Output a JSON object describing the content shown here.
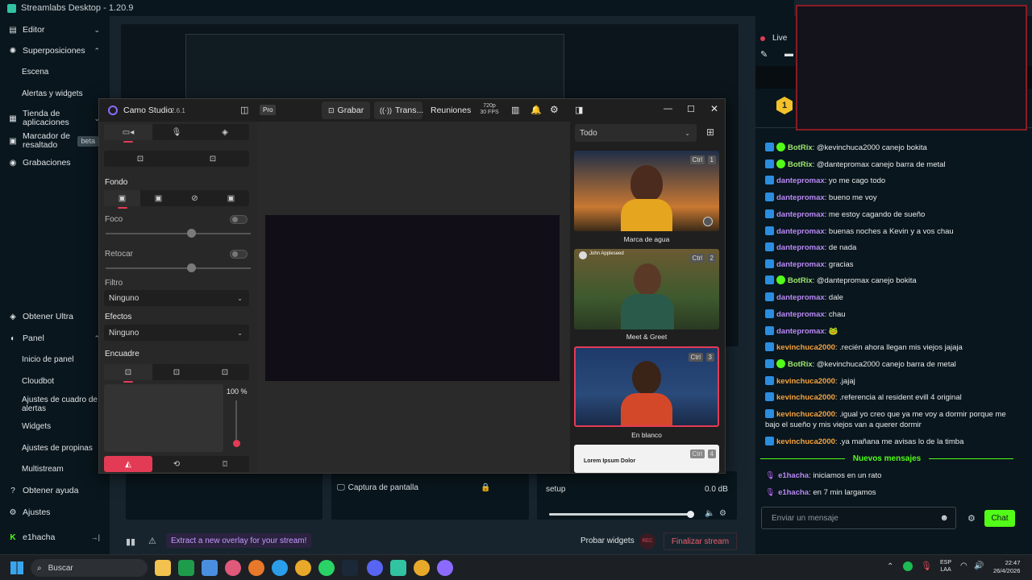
{
  "titlebar": {
    "title": "Streamlabs Desktop - 1.20.9"
  },
  "sidebar": {
    "items": [
      {
        "label": "Editor",
        "icon": "editor-icon"
      },
      {
        "label": "Superposiciones",
        "icon": "overlays-icon"
      },
      {
        "label": "Escena"
      },
      {
        "label": "Alertas y widgets"
      },
      {
        "label": "Tienda de aplicaciones",
        "icon": "store-icon"
      },
      {
        "label": "Marcador de resaltado",
        "icon": "highlighter-icon",
        "badge": "beta"
      },
      {
        "label": "Grabaciones",
        "icon": "recordings-icon"
      }
    ],
    "bottom": [
      {
        "label": "Obtener Ultra",
        "icon": "ultra-icon"
      },
      {
        "label": "Panel",
        "icon": "dashboard-icon"
      },
      {
        "label": "Inicio de panel"
      },
      {
        "label": "Cloudbot"
      },
      {
        "label": "Ajustes de cuadro de alertas"
      },
      {
        "label": "Widgets"
      },
      {
        "label": "Ajustes de propinas"
      },
      {
        "label": "Multistream"
      },
      {
        "label": "Obtener ayuda",
        "icon": "help-icon"
      },
      {
        "label": "Ajustes",
        "icon": "settings-icon"
      },
      {
        "label": "e1hacha",
        "icon": "kick-icon"
      }
    ]
  },
  "camo": {
    "app_name": "Camo Studio",
    "version": "2.6.1",
    "pro": "Pro",
    "record": "Grabar",
    "stream": "Trans...",
    "meetings": "Reuniones",
    "res": "720p",
    "fps": "30 FPS",
    "section_fondo": "Fondo",
    "foco": "Foco",
    "retocar": "Retocar",
    "filtro": "Filtro",
    "filtro_value": "Ninguno",
    "efectos": "Efectos",
    "efectos_value": "Ninguno",
    "encuadre": "Encuadre",
    "zoom": "100 %",
    "filter_select": "Todo",
    "overlays": [
      {
        "caption": "Marca de agua",
        "key": "Ctrl",
        "num": "1"
      },
      {
        "caption": "Meet & Greet",
        "key": "Ctrl",
        "num": "2",
        "person": "John Appleseed"
      },
      {
        "caption": "En blanco",
        "key": "Ctrl",
        "num": "3"
      },
      {
        "caption": "Lorem Ipsum Dolor",
        "key": "Ctrl",
        "num": "4"
      }
    ]
  },
  "mixer": {
    "source": "Captura de pantalla",
    "audio_name": "setup",
    "audio_level": "0.0 dB",
    "volume_level": 1.0
  },
  "footer": {
    "overlay_tip": "Extract a new overlay for your stream!",
    "test_widgets": "Probar widgets",
    "rec": "REC",
    "end_stream": "Finalizar stream"
  },
  "chat": {
    "live": "Live",
    "messages": [
      {
        "user": "BotRix",
        "text": ": @kevinchuca2000 canejo bokita",
        "color": "#9fe870",
        "badges": 2
      },
      {
        "user": "BotRix",
        "text": ": @dantepromax canejo barra de metal",
        "color": "#9fe870",
        "badges": 2
      },
      {
        "user": "dantepromax",
        "text": ": yo me cago todo",
        "color": "#b889f5",
        "badges": 1
      },
      {
        "user": "dantepromax",
        "text": ": bueno me voy",
        "color": "#b889f5",
        "badges": 1
      },
      {
        "user": "dantepromax",
        "text": ": me estoy cagando de sueño",
        "color": "#b889f5",
        "badges": 1
      },
      {
        "user": "dantepromax",
        "text": ": buenas noches a Kevin y a vos chau",
        "color": "#b889f5",
        "badges": 1
      },
      {
        "user": "dantepromax",
        "text": ": de nada",
        "color": "#b889f5",
        "badges": 1
      },
      {
        "user": "dantepromax",
        "text": ": gracias",
        "color": "#b889f5",
        "badges": 1
      },
      {
        "user": "BotRix",
        "text": ": @dantepromax canejo bokita",
        "color": "#9fe870",
        "badges": 2
      },
      {
        "user": "dantepromax",
        "text": ": dale",
        "color": "#b889f5",
        "badges": 1
      },
      {
        "user": "dantepromax",
        "text": ": chau",
        "color": "#b889f5",
        "badges": 1
      },
      {
        "user": "dantepromax",
        "text": ": 🐸",
        "color": "#b889f5",
        "badges": 1
      },
      {
        "user": "kevinchuca2000",
        "text": ": .recién ahora llegan mis viejos jajaja",
        "color": "#f6a23e",
        "badges": 1
      },
      {
        "user": "BotRix",
        "text": ": @kevinchuca2000 canejo barra de metal",
        "color": "#9fe870",
        "badges": 2
      },
      {
        "user": "kevinchuca2000",
        "text": ": .jajaj",
        "color": "#f6a23e",
        "badges": 1
      },
      {
        "user": "kevinchuca2000",
        "text": ": .referencia al resident evill 4 original",
        "color": "#f6a23e",
        "badges": 1
      },
      {
        "user": "kevinchuca2000",
        "text": ": .igual yo creo que ya me voy a dormir porque me bajo el sueño y mis viejos van a querer dormir",
        "color": "#f6a23e",
        "badges": 1
      },
      {
        "user": "kevinchuca2000",
        "text": ": .ya mañana me avisas lo de la timba",
        "color": "#f6a23e",
        "badges": 1
      }
    ],
    "new_messages": "Nuevos mensajes",
    "new": [
      {
        "user": "e1hacha",
        "text": ": iniciamos en un rato",
        "color": "#b889f5"
      },
      {
        "user": "e1hacha",
        "text": ": en 7 min largamos",
        "color": "#b889f5"
      }
    ],
    "placeholder": "Enviar un mensaje",
    "send": "Chat"
  },
  "taskbar": {
    "search": "Buscar",
    "lang1": "ESP",
    "lang2": "LAA",
    "time": "22:47",
    "date": "26/4/2026"
  }
}
